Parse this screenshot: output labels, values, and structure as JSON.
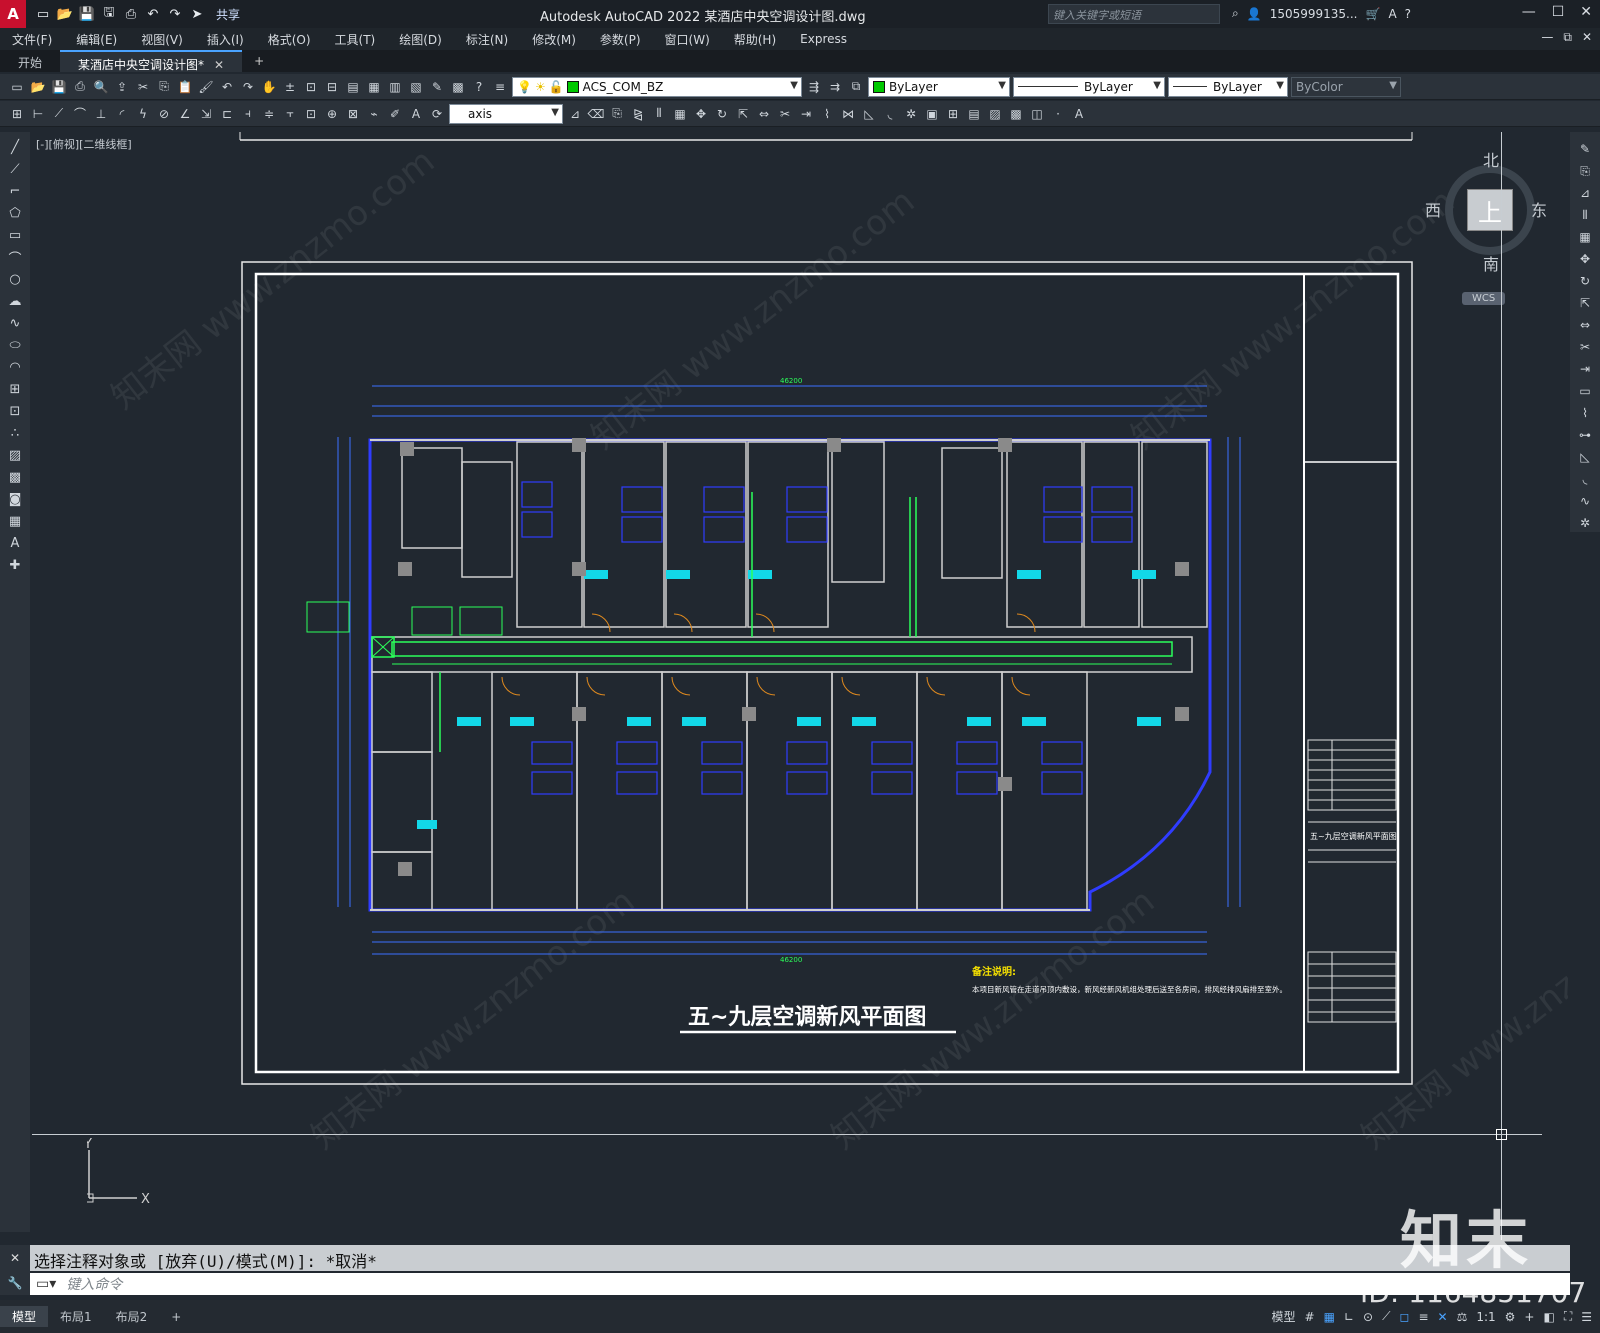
{
  "titlebar": {
    "logo": "A",
    "share": "共享",
    "app_title": "Autodesk AutoCAD 2022    某酒店中央空调设计图.dwg",
    "search_placeholder": "键入关键字或短语",
    "user": "1505999135...",
    "help": "?"
  },
  "menu": [
    "文件(F)",
    "编辑(E)",
    "视图(V)",
    "插入(I)",
    "格式(O)",
    "工具(T)",
    "绘图(D)",
    "标注(N)",
    "修改(M)",
    "参数(P)",
    "窗口(W)",
    "帮助(H)",
    "Express"
  ],
  "tabs": {
    "start": "开始",
    "active": "某酒店中央空调设计图*"
  },
  "toolbar": {
    "layer": "ACS_COM_BZ",
    "color": "ByLayer",
    "linetype": "ByLayer",
    "lineweight": "ByLayer",
    "plotstyle": "ByColor",
    "textstyle": "axis",
    "accent_color": "#00c800"
  },
  "canvas": {
    "view_label": "[-][俯视][二维线框]",
    "watermark": "知末网 www.znzmo.com",
    "drawing_title": "五~九层空调新风平面图",
    "notes_title": "备注说明:",
    "notes_text": "本项目新风管在走道吊顶内敷设，新风经新风机组处理后送至各房间，排风经排风扇排至室外。",
    "dim_top_total": "46200",
    "dim_bottom_total": "46200",
    "titleblock_name": "五~九层空调新风平面图",
    "compass": {
      "n": "北",
      "s": "南",
      "e": "东",
      "w": "西",
      "top": "上"
    },
    "wcs": "WCS",
    "ucs_x": "X",
    "ucs_y": "Y"
  },
  "command": {
    "history": "选择注释对象或 [放弃(U)/模式(M)]: *取消*",
    "placeholder": "键入命令"
  },
  "status": {
    "tabs": [
      "模型",
      "布局1",
      "布局2"
    ],
    "model_label": "模型",
    "scale": "1:1"
  },
  "branding": {
    "logo_text": "知末",
    "id": "ID: 1164851707"
  }
}
